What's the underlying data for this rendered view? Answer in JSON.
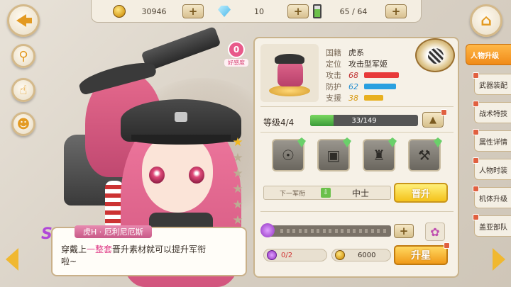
{
  "resources": {
    "gold": "30946",
    "gems": "10",
    "energy": "65 / 64"
  },
  "affinity": {
    "value": "0",
    "label": "好感度"
  },
  "character": {
    "stars_total": 6,
    "stars_filled": 1,
    "dialogue": {
      "speaker": "虎H · 厄利尼厄斯",
      "line_pre": "穿戴上",
      "line_highlight": "一整套",
      "line_post": "晋升素材就可以提升军衔",
      "line2": "啦~"
    }
  },
  "info": {
    "nation_label": "国籍",
    "nation_value": "虎系",
    "role_label": "定位",
    "role_value": "攻击型军姬",
    "attack_label": "攻击",
    "attack_value": "68",
    "defense_label": "防护",
    "defense_value": "62",
    "support_label": "支援",
    "support_value": "38"
  },
  "level": {
    "label": "等级4/4",
    "exp": "33/149",
    "exp_fraction": 0.22
  },
  "rank": {
    "next_label": "下一军衔",
    "value": "中士",
    "promote_label": "晋升"
  },
  "star_up": {
    "material": "0/2",
    "cost": "6000",
    "label": "升星"
  },
  "tabs": [
    {
      "label": "人物升级",
      "active": true
    },
    {
      "label": "武器装配",
      "active": false
    },
    {
      "label": "战术特技",
      "active": false
    },
    {
      "label": "属性详情",
      "active": false
    },
    {
      "label": "人物时装",
      "active": false
    },
    {
      "label": "机体升级",
      "active": false
    },
    {
      "label": "盖亚部队",
      "active": false
    }
  ],
  "colors": {
    "attack": "#e83a3a",
    "defense": "#2aa0e0",
    "support": "#e8b020",
    "accent": "#f39a1e"
  }
}
